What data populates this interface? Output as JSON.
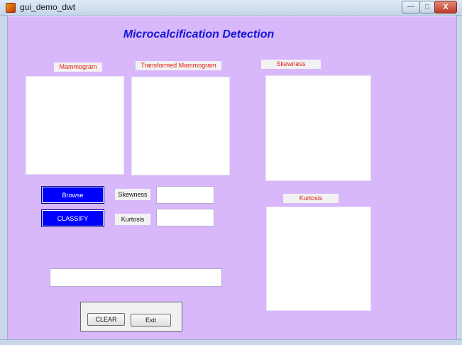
{
  "window": {
    "title": "gui_demo_dwt",
    "minimize_glyph": "—",
    "maximize_glyph": "□",
    "close_glyph": "X"
  },
  "figure": {
    "title": "Microcalcification Detection",
    "background": "#d8b8fb",
    "title_color": "#1616d8",
    "label_color": "#e0201a"
  },
  "panels": {
    "mammogram_label": "Mammogram",
    "transformed_label": "Transformed Mammogram",
    "skewness_label": "Skewness",
    "kurtosis_label": "Kurtosis"
  },
  "controls": {
    "browse_label": "Browse",
    "classify_label": "CLASSIFY",
    "skewness_text_label": "Skewness",
    "kurtosis_text_label": "Kurtosis",
    "skewness_value": "",
    "kurtosis_value": "",
    "result_value": ""
  },
  "button_group": {
    "clear_label": "CLEAR",
    "exit_label": "Exit"
  },
  "icons": [
    "matlab-app-icon",
    "minimize-icon",
    "maximize-icon",
    "close-icon"
  ]
}
